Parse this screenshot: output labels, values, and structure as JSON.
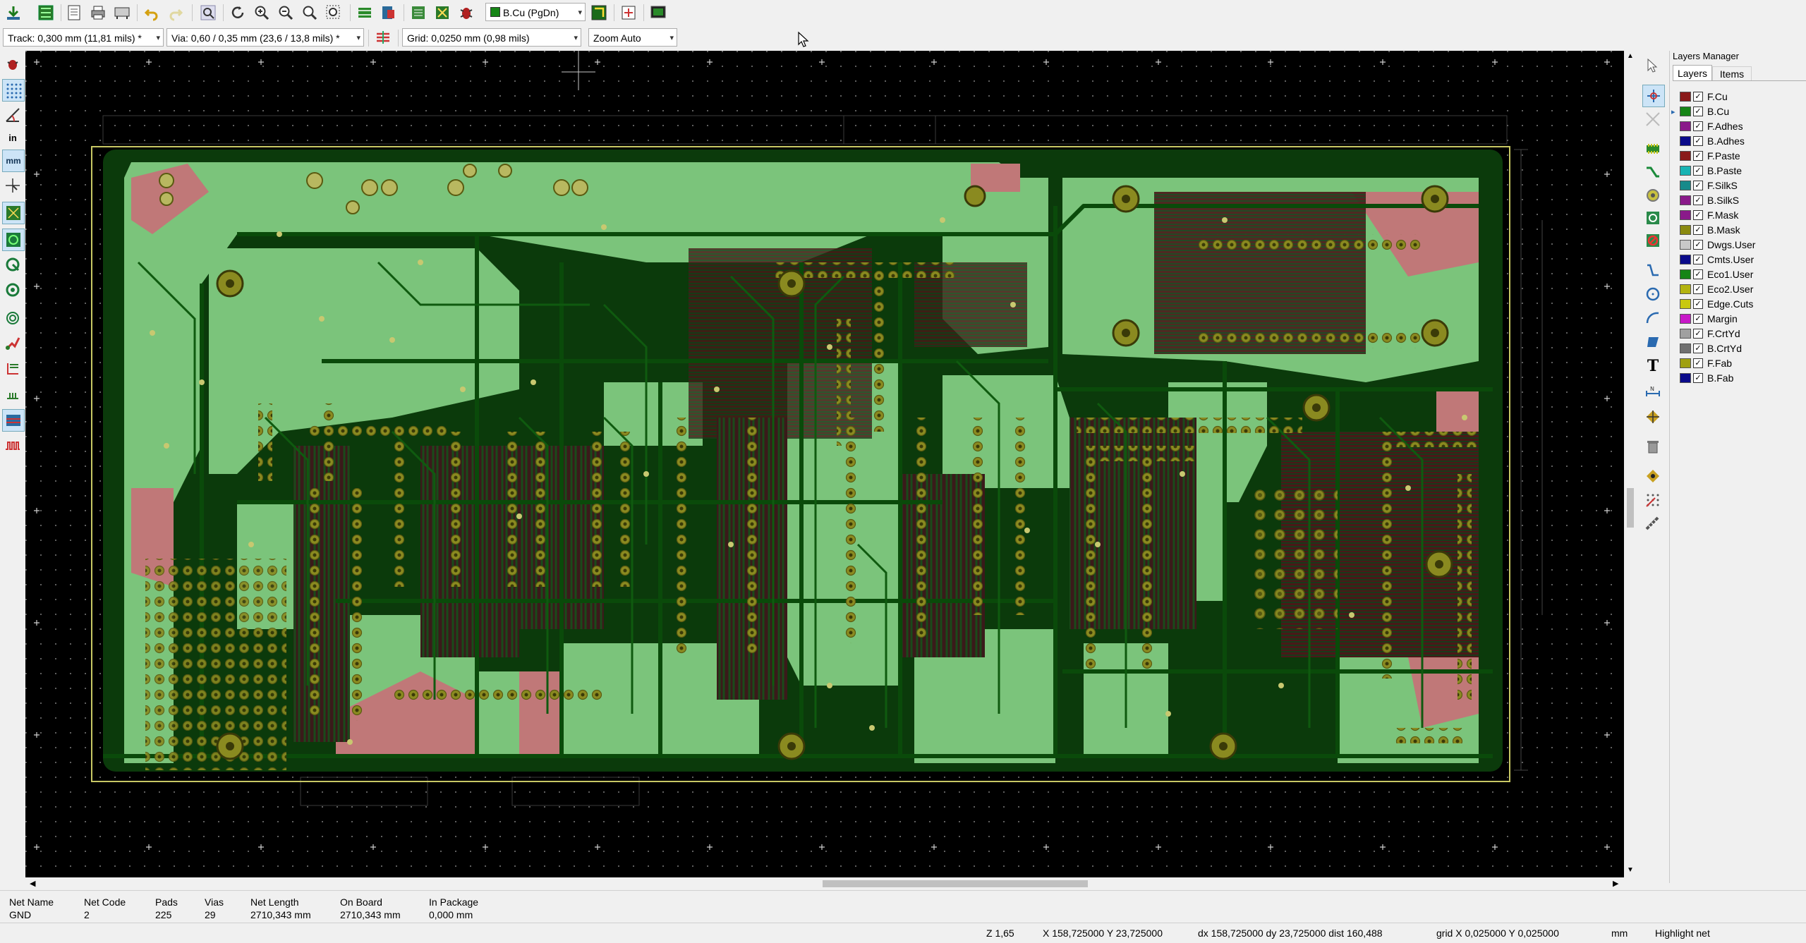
{
  "toolbar_top": {
    "layer_select": "B.Cu (PgDn)",
    "icons": [
      "save-board-icon",
      "pcb-setup-icon",
      "page-settings-icon",
      "print-icon",
      "plot-icon",
      "undo-icon",
      "redo-icon",
      "find-icon",
      "redraw-icon",
      "zoom-in-icon",
      "zoom-out-icon",
      "zoom-fit-icon",
      "zoom-selection-icon",
      "netlist-icon",
      "footprint-library-icon",
      "footprint-viewer-icon",
      "autorouter-icon",
      "drc-icon",
      "layer-pair-icon",
      "scripting-icon",
      "3d-viewer-icon"
    ]
  },
  "toolbar_options": {
    "track": "Track: 0,300 mm (11,81 mils) *",
    "via": "Via: 0,60 / 0,35 mm (23,6 / 13,8 mils) *",
    "grid": "Grid: 0,0250 mm (0,98 mils)",
    "zoom": "Zoom Auto"
  },
  "layers_manager": {
    "title": "Layers Manager",
    "tabs": [
      "Layers",
      "Items"
    ],
    "active_layer": "B.Cu",
    "layers": [
      {
        "name": "F.Cu",
        "color": "#8a1a1a"
      },
      {
        "name": "B.Cu",
        "color": "#168516"
      },
      {
        "name": "F.Adhes",
        "color": "#8a1a8a"
      },
      {
        "name": "B.Adhes",
        "color": "#0a0a8a"
      },
      {
        "name": "F.Paste",
        "color": "#8a1a1a"
      },
      {
        "name": "B.Paste",
        "color": "#18b4b4"
      },
      {
        "name": "F.SilkS",
        "color": "#168a8a"
      },
      {
        "name": "B.SilkS",
        "color": "#8a1a8a"
      },
      {
        "name": "F.Mask",
        "color": "#8a1a8a"
      },
      {
        "name": "B.Mask",
        "color": "#8a8a10"
      },
      {
        "name": "Dwgs.User",
        "color": "#c8c8c8"
      },
      {
        "name": "Cmts.User",
        "color": "#0a0a8a"
      },
      {
        "name": "Eco1.User",
        "color": "#168516"
      },
      {
        "name": "Eco2.User",
        "color": "#b4b410"
      },
      {
        "name": "Edge.Cuts",
        "color": "#c8c810"
      },
      {
        "name": "Margin",
        "color": "#c818c8"
      },
      {
        "name": "F.CrtYd",
        "color": "#a0a0a0"
      },
      {
        "name": "B.CrtYd",
        "color": "#707070"
      },
      {
        "name": "F.Fab",
        "color": "#a0a010"
      },
      {
        "name": "B.Fab",
        "color": "#0a0a8a"
      }
    ]
  },
  "message_panel": {
    "headers": [
      "Net Name",
      "Net Code",
      "Pads",
      "Vias",
      "Net Length",
      "On Board",
      "In Package"
    ],
    "values": [
      "GND",
      "2",
      "225",
      "29",
      "2710,343 mm",
      "2710,343 mm",
      "0,000 mm"
    ]
  },
  "status_bar": {
    "zoom": "Z 1,65",
    "xy": "X 158,725000  Y 23,725000",
    "delta": "dx 158,725000  dy 23,725000  dist 160,488",
    "grid": "grid X 0,025000  Y 0,025000",
    "units": "mm",
    "mode": "Highlight net"
  },
  "left_toolbar_icons": [
    "drc-off-icon",
    "grid-toggle-icon",
    "polar-coords-icon",
    "inch-units-icon",
    "mm-units-icon",
    "cursor-shape-icon",
    "ratsnest-icon",
    "local-ratsnest-icon",
    "zone-fill-icon",
    "zone-outline-icon",
    "pad-sketch-icon",
    "via-sketch-icon",
    "track-sketch-icon",
    "high-contrast-icon",
    "microwave-icon"
  ],
  "right_toolbar_icons": [
    "select-icon",
    "highlight-net-icon",
    "local-ratsnest-icon",
    "add-footprint-icon",
    "route-track-icon",
    "add-via-icon",
    "add-zone-icon",
    "add-keepout-icon",
    "add-line-icon",
    "add-circle-icon",
    "add-arc-icon",
    "add-polygon-icon",
    "add-text-icon",
    "add-dimension-icon",
    "add-target-icon",
    "delete-icon",
    "set-origin-icon",
    "grid-origin-icon",
    "measure-icon"
  ],
  "colors": {
    "board_fill": "#7bc47b",
    "track": "#0a4a0a",
    "front_copper": "#c07070",
    "pad": "#8a8a20",
    "canvas": "#000000",
    "edge": "#c8c864"
  }
}
